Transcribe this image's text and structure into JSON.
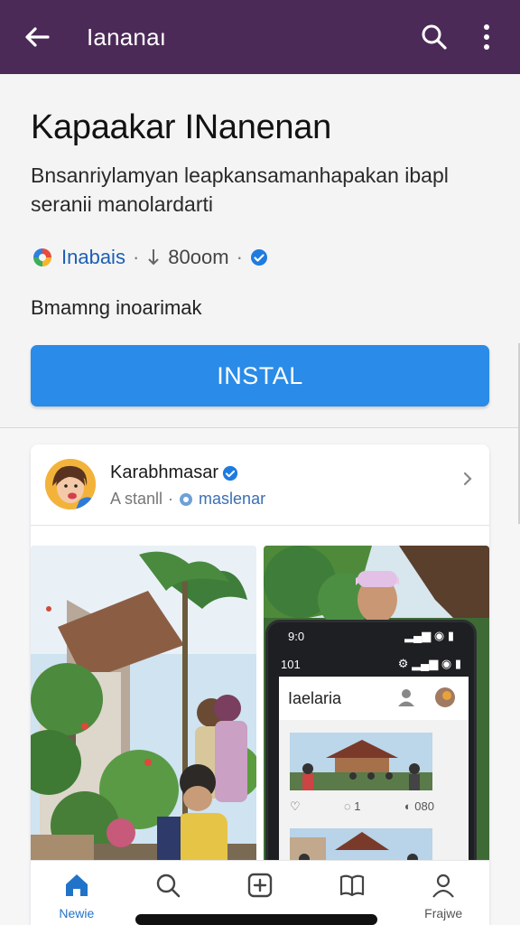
{
  "appbar": {
    "title": "Iananaı",
    "bg_color": "#4c2a58",
    "icons": [
      "back-arrow-icon",
      "search-icon",
      "more-vert-icon"
    ]
  },
  "app": {
    "name": "Kapaakar INanenan",
    "description": "Bnsanriylamyan leapkansamanhapakan ibapl seranii manolardarti",
    "developer": "Inabais",
    "downloads": "80oom",
    "subline": "Bmamng inoarimak",
    "install_label": "INSTAL",
    "accent_color": "#2a8be8"
  },
  "post": {
    "author": "Karabhmasar",
    "meta": "A stanll",
    "location": "maslenar"
  },
  "phone_screen": {
    "time": "9:0",
    "status_left": "101",
    "title": "Iaelaria",
    "comments": "1",
    "views": "080"
  },
  "nav": {
    "items": [
      {
        "label": "Newie",
        "icon": "home-icon",
        "active": true
      },
      {
        "label": "",
        "icon": "search-icon",
        "active": false
      },
      {
        "label": "",
        "icon": "add-box-icon",
        "active": false
      },
      {
        "label": "",
        "icon": "book-icon",
        "active": false
      },
      {
        "label": "Frajwe",
        "icon": "profile-icon",
        "active": false
      }
    ]
  }
}
